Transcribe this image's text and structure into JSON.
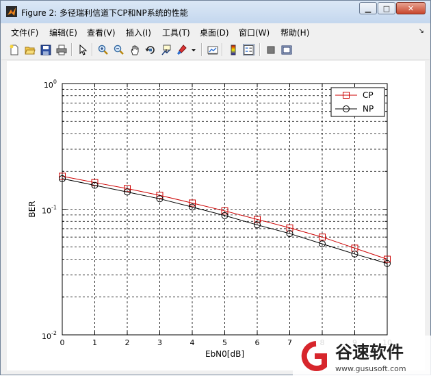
{
  "window": {
    "title": "Figure 2: 多径瑞利信道下CP和NP系统的性能",
    "min_glyph": "▁",
    "max_glyph": "□",
    "close_glyph": "✕"
  },
  "menu": [
    {
      "label": "文件(F)"
    },
    {
      "label": "编辑(E)"
    },
    {
      "label": "查看(V)"
    },
    {
      "label": "插入(I)"
    },
    {
      "label": "工具(T)"
    },
    {
      "label": "桌面(D)"
    },
    {
      "label": "窗口(W)"
    },
    {
      "label": "帮助(H)"
    }
  ],
  "menu_corner": "↘",
  "toolbar": {
    "icons": [
      "new-figure-icon",
      "open-file-icon",
      "save-icon",
      "print-icon",
      "pointer-icon",
      "zoom-in-icon",
      "zoom-out-icon",
      "pan-icon",
      "rotate-icon",
      "data-cursor-icon",
      "brush-icon",
      "link-plot-icon",
      "colorbar-icon",
      "legend-icon",
      "hide-plot-tools-icon",
      "show-plot-tools-icon"
    ]
  },
  "chart_data": {
    "type": "line",
    "title": "",
    "xlabel": "EbN0[dB]",
    "ylabel": "BER",
    "x": [
      0,
      1,
      2,
      3,
      4,
      5,
      6,
      7,
      8,
      9,
      10
    ],
    "xlim": [
      0,
      10
    ],
    "ylim": [
      0.01,
      1
    ],
    "yscale": "log",
    "xticks": [
      "0",
      "1",
      "2",
      "3",
      "4",
      "5",
      "6",
      "7",
      "8",
      "9",
      "10"
    ],
    "yticks": [
      {
        "base": "10",
        "exp": "-2",
        "value": 0.01
      },
      {
        "base": "10",
        "exp": "-1",
        "value": 0.1
      },
      {
        "base": "10",
        "exp": "0",
        "value": 1
      }
    ],
    "grid": true,
    "legend": "top-right",
    "series": [
      {
        "name": "CP",
        "color": "#cc0000",
        "marker": "square",
        "values": [
          0.183,
          0.163,
          0.146,
          0.129,
          0.112,
          0.097,
          0.083,
          0.071,
          0.06,
          0.049,
          0.04
        ]
      },
      {
        "name": "NP",
        "color": "#000000",
        "marker": "circle",
        "values": [
          0.175,
          0.155,
          0.137,
          0.121,
          0.104,
          0.089,
          0.075,
          0.064,
          0.053,
          0.044,
          0.037
        ]
      }
    ]
  },
  "watermark": {
    "brand": "谷速软件",
    "url": "www.gususoft.com",
    "color": "#d7262c"
  }
}
